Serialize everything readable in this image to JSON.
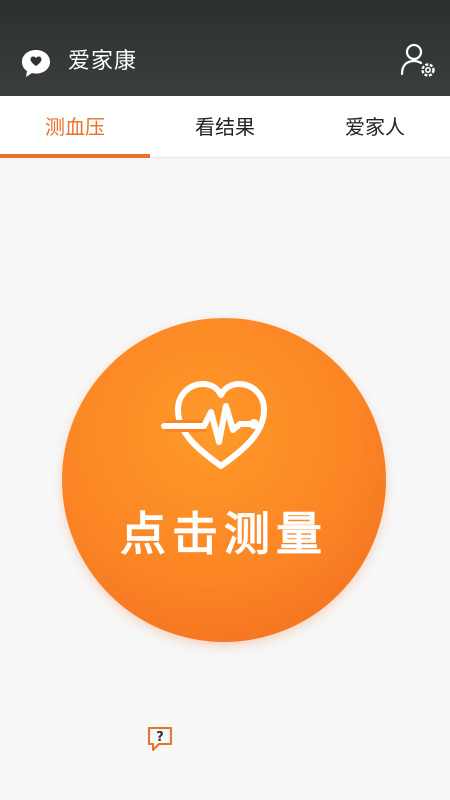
{
  "app": {
    "title": "爱家康",
    "logo_icon": "chat-heart-logo-icon",
    "settings_icon": "user-settings-icon"
  },
  "tabs": [
    {
      "label": "测血压",
      "active": true
    },
    {
      "label": "看结果",
      "active": false
    },
    {
      "label": "爱家人",
      "active": false
    }
  ],
  "main": {
    "measure_button_label": "点击测量",
    "measure_icon": "heart-pulse-icon",
    "help_icon": "help-question-icon"
  },
  "colors": {
    "accent": "#e9702a",
    "appbar": "#2f3333",
    "button_orange": "#fb8424",
    "background": "#f7f7f7"
  }
}
